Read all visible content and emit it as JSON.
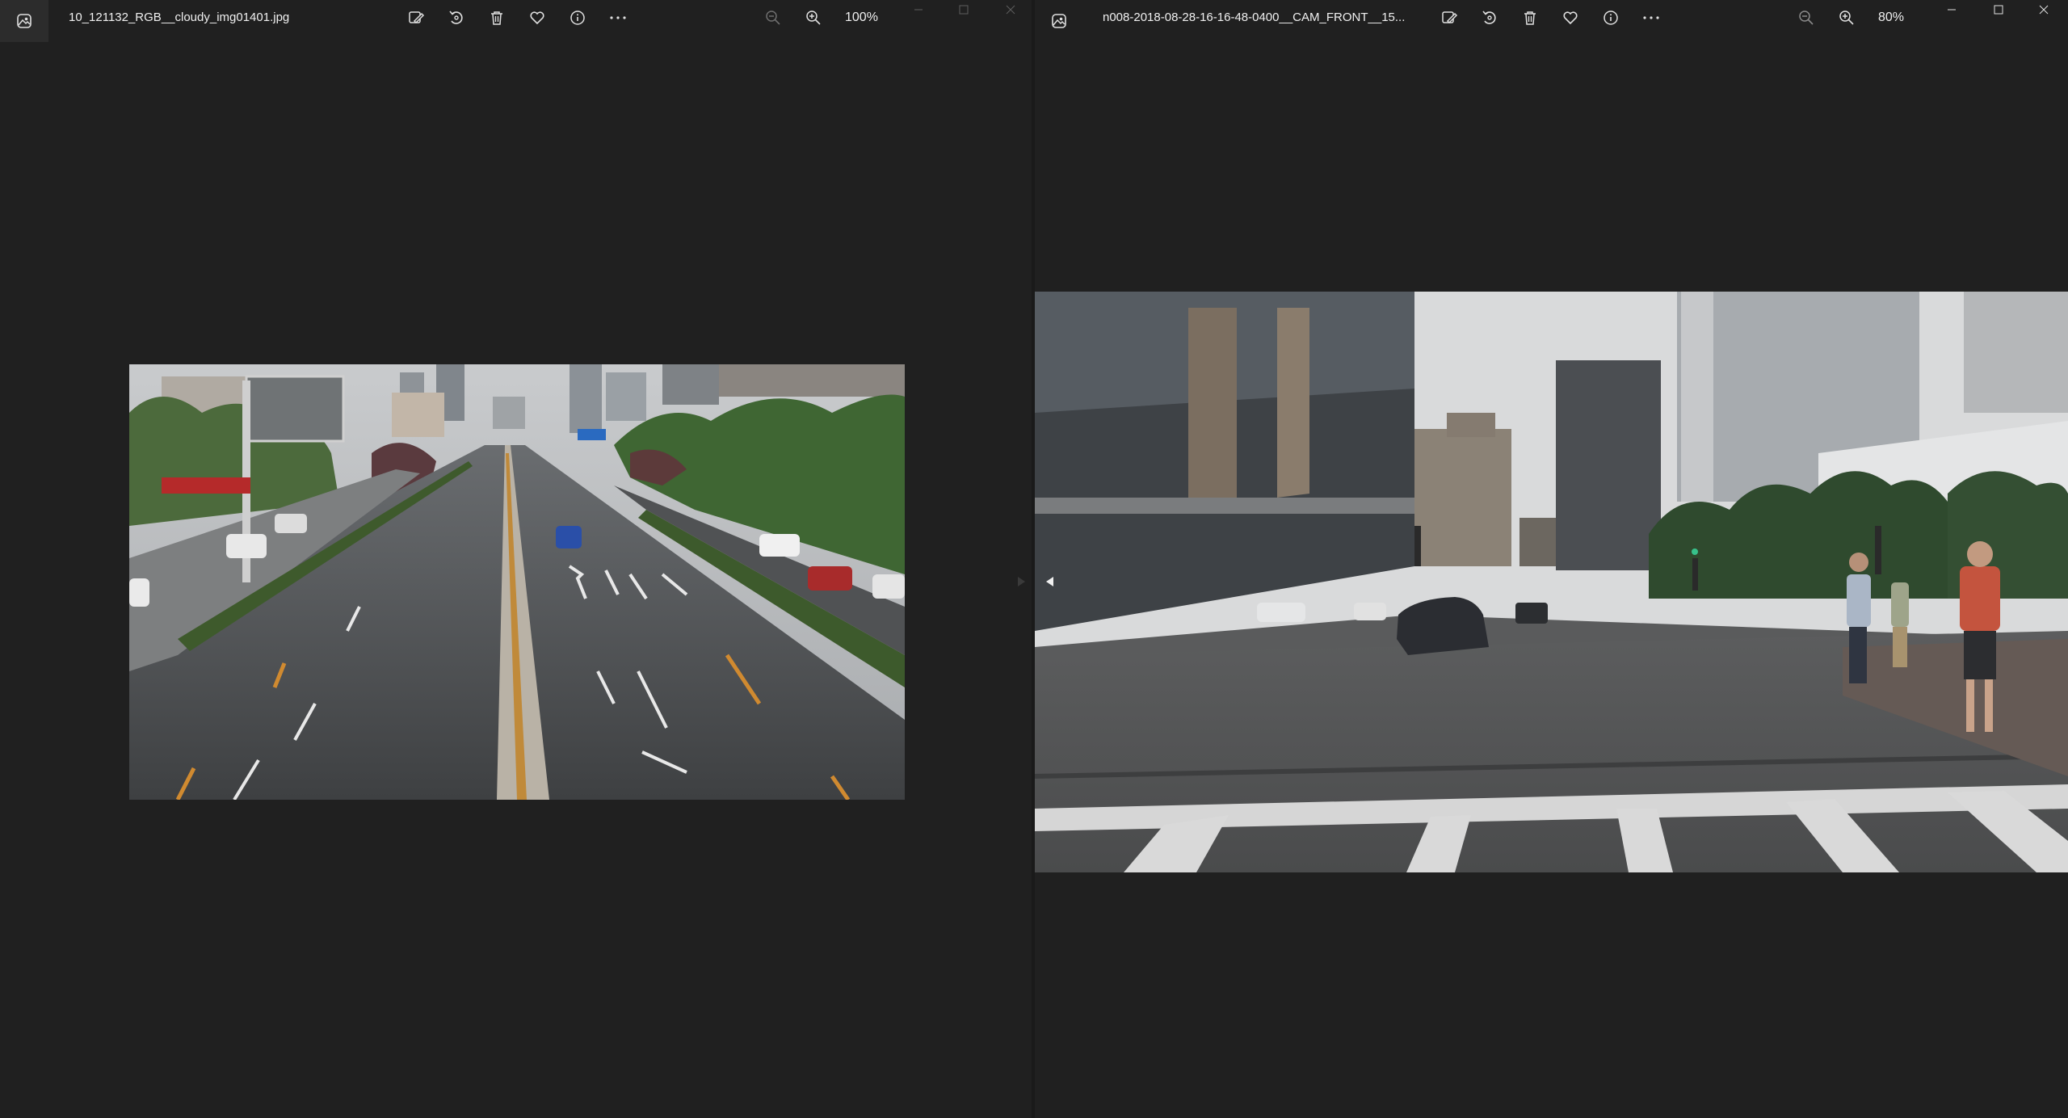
{
  "left_viewer": {
    "filename": "10_121132_RGB__cloudy_img01401.jpg",
    "zoom": "100%",
    "icons": {
      "app": "photos-app-icon",
      "edit": "edit-image-icon",
      "rotate": "rotate-icon",
      "delete": "delete-icon",
      "favorite": "heart-icon",
      "info": "info-icon",
      "more": "more-icon",
      "zoom_out": "zoom-out-icon",
      "zoom_in": "zoom-in-icon"
    }
  },
  "right_viewer": {
    "filename": "n008-2018-08-28-16-16-48-0400__CAM_FRONT__15...",
    "zoom": "80%",
    "icons": {
      "app": "photos-app-icon",
      "edit": "edit-image-icon",
      "rotate": "rotate-icon",
      "delete": "delete-icon",
      "favorite": "heart-icon",
      "info": "info-icon",
      "more": "more-icon",
      "zoom_out": "zoom-out-icon",
      "zoom_in": "zoom-in-icon"
    }
  },
  "colors": {
    "background": "#202020",
    "toolbar_icon": "#e0e0e0",
    "disabled_icon": "#6e6e6e"
  }
}
